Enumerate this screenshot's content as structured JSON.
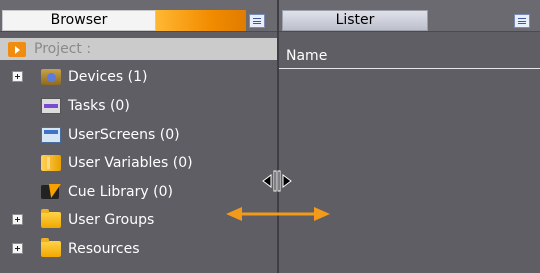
{
  "browser": {
    "tab_label": "Browser",
    "project_label": "Project :",
    "tree": [
      {
        "label": "Devices (1)",
        "icon": "devices-icon",
        "expandable": true
      },
      {
        "label": "Tasks (0)",
        "icon": "tasks-icon",
        "expandable": false
      },
      {
        "label": "UserScreens (0)",
        "icon": "user-screens-icon",
        "expandable": false
      },
      {
        "label": "User Variables (0)",
        "icon": "user-variables-icon",
        "expandable": false
      },
      {
        "label": "Cue Library (0)",
        "icon": "cue-library-icon",
        "expandable": false
      },
      {
        "label": "User Groups",
        "icon": "folder-icon",
        "expandable": true
      },
      {
        "label": "Resources",
        "icon": "folder-icon",
        "expandable": true
      }
    ]
  },
  "lister": {
    "tab_label": "Lister",
    "column_name": "Name"
  },
  "colors": {
    "panel_bg": "#5e5e64",
    "accent_orange": "#f28c00",
    "text": "#ffffff"
  }
}
